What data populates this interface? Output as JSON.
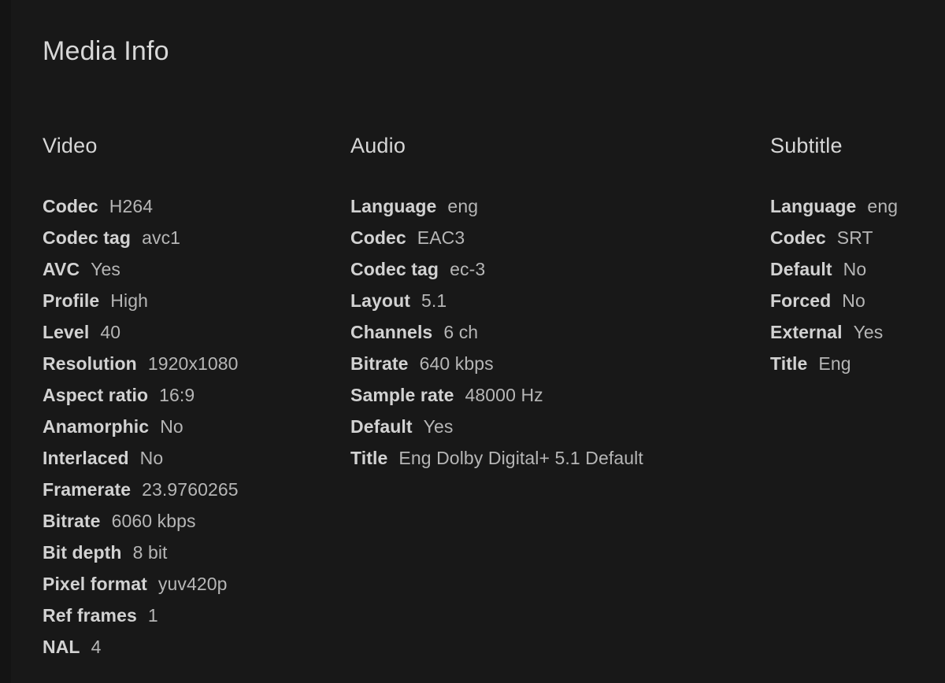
{
  "page": {
    "title": "Media Info",
    "background_color": "#181818",
    "label_color": "#d2d2d2",
    "value_color": "#b6b6b6",
    "title_color": "#d8d8d8"
  },
  "columns": [
    {
      "id": "video",
      "header": "Video",
      "rows": [
        {
          "label": "Codec",
          "value": "H264"
        },
        {
          "label": "Codec tag",
          "value": "avc1"
        },
        {
          "label": "AVC",
          "value": "Yes"
        },
        {
          "label": "Profile",
          "value": "High"
        },
        {
          "label": "Level",
          "value": "40"
        },
        {
          "label": "Resolution",
          "value": "1920x1080"
        },
        {
          "label": "Aspect ratio",
          "value": "16:9"
        },
        {
          "label": "Anamorphic",
          "value": "No"
        },
        {
          "label": "Interlaced",
          "value": "No"
        },
        {
          "label": "Framerate",
          "value": "23.9760265"
        },
        {
          "label": "Bitrate",
          "value": "6060 kbps"
        },
        {
          "label": "Bit depth",
          "value": "8 bit"
        },
        {
          "label": "Pixel format",
          "value": "yuv420p"
        },
        {
          "label": "Ref frames",
          "value": "1"
        },
        {
          "label": "NAL",
          "value": "4"
        }
      ]
    },
    {
      "id": "audio",
      "header": "Audio",
      "rows": [
        {
          "label": "Language",
          "value": "eng"
        },
        {
          "label": "Codec",
          "value": "EAC3"
        },
        {
          "label": "Codec tag",
          "value": "ec-3"
        },
        {
          "label": "Layout",
          "value": "5.1"
        },
        {
          "label": "Channels",
          "value": "6 ch"
        },
        {
          "label": "Bitrate",
          "value": "640 kbps"
        },
        {
          "label": "Sample rate",
          "value": "48000 Hz"
        },
        {
          "label": "Default",
          "value": "Yes"
        },
        {
          "label": "Title",
          "value": "Eng Dolby Digital+ 5.1 Default"
        }
      ]
    },
    {
      "id": "subtitle",
      "header": "Subtitle",
      "rows": [
        {
          "label": "Language",
          "value": "eng"
        },
        {
          "label": "Codec",
          "value": "SRT"
        },
        {
          "label": "Default",
          "value": "No"
        },
        {
          "label": "Forced",
          "value": "No"
        },
        {
          "label": "External",
          "value": "Yes"
        },
        {
          "label": "Title",
          "value": "Eng"
        }
      ]
    }
  ]
}
